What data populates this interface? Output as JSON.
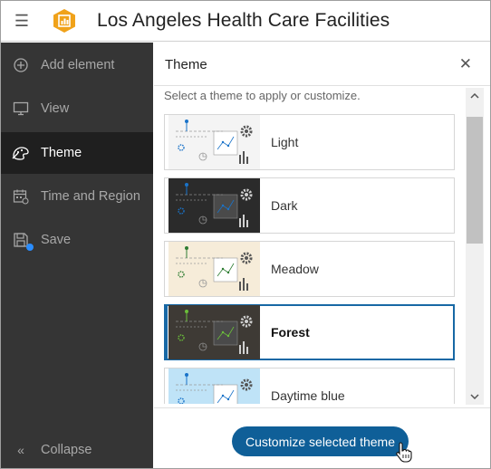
{
  "header": {
    "menu_icon": "hamburger-menu-icon",
    "logo_icon": "dashboard-logo-icon",
    "title": "Los Angeles Health Care Facilities"
  },
  "sidebar": {
    "items": [
      {
        "label": "Add element",
        "icon": "plus-circle-icon"
      },
      {
        "label": "View",
        "icon": "monitor-icon"
      },
      {
        "label": "Theme",
        "icon": "palette-icon",
        "active": true
      },
      {
        "label": "Time and Region",
        "icon": "calendar-globe-icon"
      },
      {
        "label": "Save",
        "icon": "save-icon"
      }
    ],
    "collapse_label": "Collapse",
    "collapse_icon": "double-chevron-left-icon"
  },
  "panel": {
    "title": "Theme",
    "close_icon": "close-icon",
    "instructions": "Select a theme to apply or customize.",
    "themes": [
      {
        "name": "Light",
        "bg": "#f4f4f4",
        "accent": "#1a73c9"
      },
      {
        "name": "Dark",
        "bg": "#2b2b2b",
        "accent": "#1a73c9"
      },
      {
        "name": "Meadow",
        "bg": "#f6ecd9",
        "accent": "#2e7d32"
      },
      {
        "name": "Forest",
        "bg": "#3e3a35",
        "accent": "#6bbf3a",
        "selected": true
      },
      {
        "name": "Daytime blue",
        "bg": "#bfe3f7",
        "accent": "#1a73c9"
      }
    ],
    "customize_button": "Customize selected theme"
  },
  "colors": {
    "sidebar_bg": "#353535",
    "sidebar_active_bg": "#1f1f1f",
    "primary": "#0f5f98",
    "selection_border": "#1768a5",
    "logo": "#f0a21a",
    "badge": "#2a8dff"
  }
}
